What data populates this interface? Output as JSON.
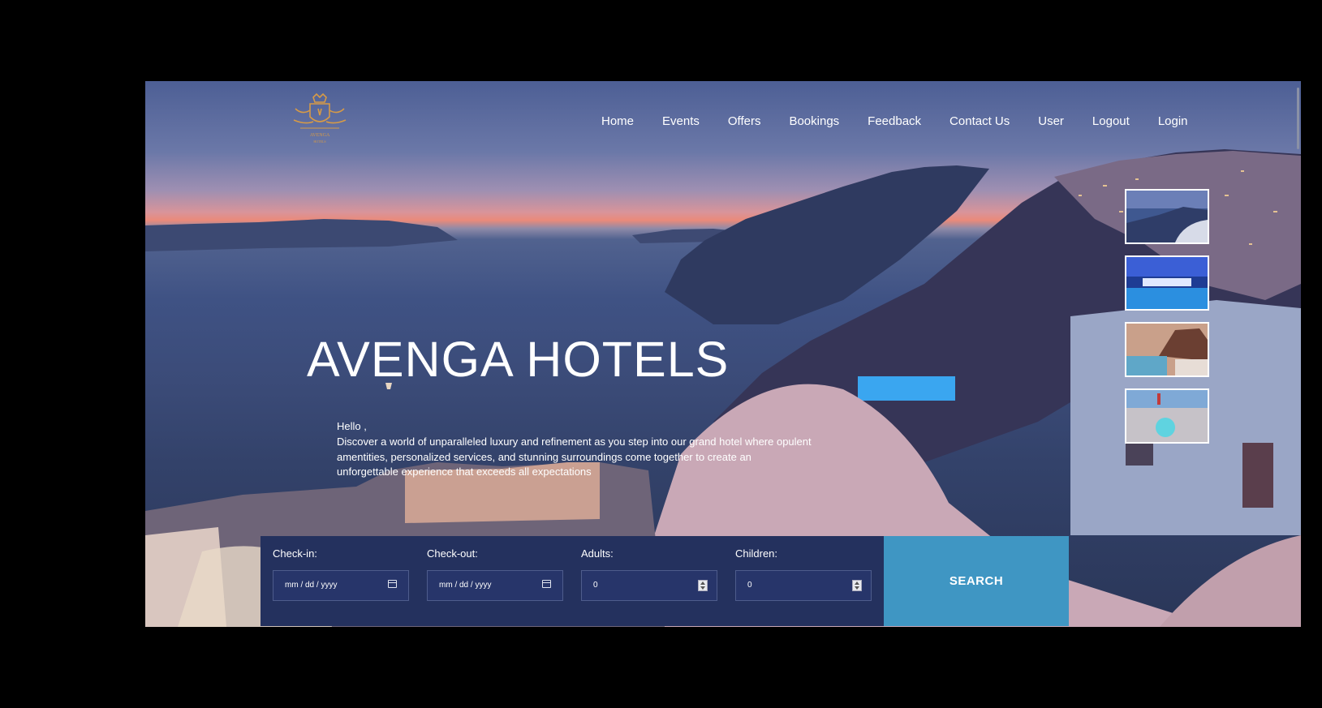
{
  "brand": {
    "name": "AVENGA HOTELS",
    "logo_icon": "crest-logo-icon",
    "logo_color": "#d69a47"
  },
  "nav": {
    "items": [
      {
        "label": "Home"
      },
      {
        "label": "Events"
      },
      {
        "label": "Offers"
      },
      {
        "label": "Bookings"
      },
      {
        "label": "Feedback"
      },
      {
        "label": "Contact Us"
      },
      {
        "label": "User"
      },
      {
        "label": "Logout"
      },
      {
        "label": "Login"
      }
    ]
  },
  "hero": {
    "title": "AVENGA HOTELS",
    "greeting": "Hello ,",
    "description": "Discover a world of unparalleled luxury and refinement as you step into our grand hotel where opulent amentities, personalized services, and stunning surroundings come together to create an unforgettable experience that exceeds all expectations"
  },
  "gallery": {
    "thumbnails": [
      "coast-thumbnail",
      "pool-night-thumbnail",
      "resort-pool-thumbnail",
      "cruise-deck-thumbnail"
    ]
  },
  "booking": {
    "checkin": {
      "label": "Check-in:",
      "value": "mm / dd / yyyy",
      "icon": "calendar-icon"
    },
    "checkout": {
      "label": "Check-out:",
      "value": "mm / dd / yyyy",
      "icon": "calendar-icon"
    },
    "adults": {
      "label": "Adults:",
      "value": "0",
      "icon": "spinner-icon"
    },
    "children": {
      "label": "Children:",
      "value": "0",
      "icon": "spinner-icon"
    },
    "search_label": "SEARCH"
  },
  "colors": {
    "panel": "#24315e",
    "search_button": "#3f96c3",
    "accent_gold": "#d69a47"
  }
}
